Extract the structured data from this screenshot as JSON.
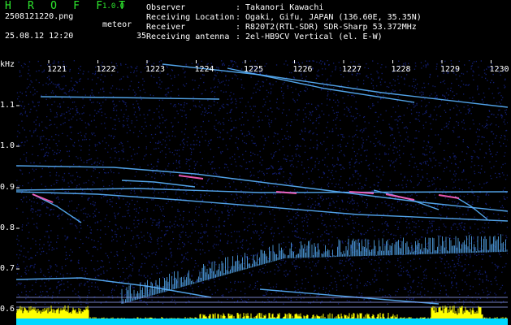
{
  "app": {
    "logo": "H R O F F T",
    "version": "1.0.0"
  },
  "file": {
    "name": "2508121220.png",
    "datetime": "25.08.12 12:20"
  },
  "meteor": {
    "label": "meteor",
    "count": "35"
  },
  "info": [
    {
      "key": "Observer",
      "value": ": Takanori Kawachi"
    },
    {
      "key": "Receiving Location",
      "value": ": Ogaki, Gifu, JAPAN (136.60E, 35.35N)"
    },
    {
      "key": "Receiver",
      "value": ": R820T2(RTL-SDR) SDR-Sharp 53.372MHz"
    },
    {
      "key": "Receiving antenna",
      "value": ": 2el-HB9CV Vertical (el. E-W)"
    }
  ],
  "axis": {
    "y_unit": "kHz",
    "y_ticks": [
      "1.1",
      "1.0",
      "0.9",
      "0.8",
      "0.7",
      "0.6"
    ],
    "x_ticks": [
      "1221",
      "1222",
      "1223",
      "1224",
      "1225",
      "1226",
      "1227",
      "1228",
      "1229",
      "1230"
    ]
  },
  "colors": {
    "logo": "#2ee82e",
    "noise": "#1a2a9c",
    "trace": "#5ab4ff",
    "intensity": "#ffff00",
    "base": "#00d8ff"
  }
}
